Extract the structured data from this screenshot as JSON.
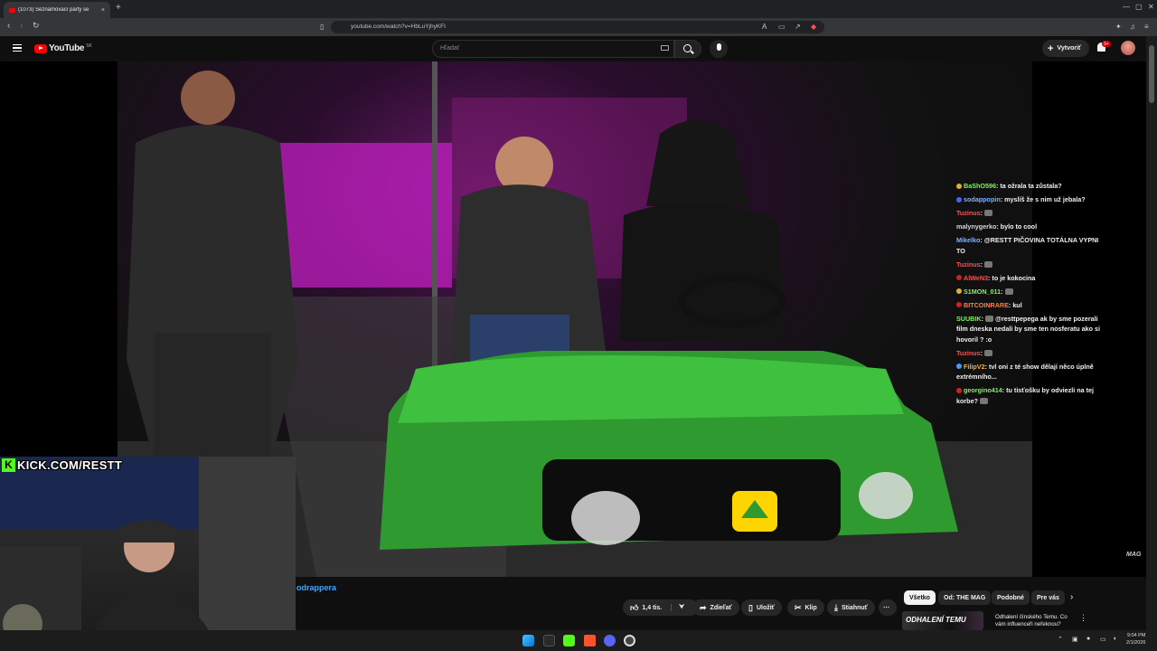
{
  "browser": {
    "tab_title": "(1073) Seznamovací party se",
    "url": "youtube.com/watch?v=HbLuYjhyKFI",
    "new_tab_label": "+",
    "close_tab_label": "×"
  },
  "youtube": {
    "logo_text": "YouTube",
    "region": "SK",
    "search_placeholder": "Hľadať",
    "create_label": "Vytvoriť",
    "notification_count": "9+"
  },
  "video": {
    "watermark": "MAG",
    "channel_name_partial": "odrappera"
  },
  "chat": {
    "messages": [
      {
        "user": "BaShO596",
        "user_color": "#7ef55a",
        "badge_color": "#e0b030",
        "text": "ta ožrala ta zůstala?"
      },
      {
        "user": "sodappopin",
        "user_color": "#7ab4ff",
        "badge_color": "#4466ff",
        "text": "myslíš že s nim už jebala?"
      },
      {
        "user": "Tuzinus",
        "user_color": "#ff5050",
        "badge_color": "",
        "text": "",
        "emote": true
      },
      {
        "user": "malynygerko",
        "user_color": "#d8d8d8",
        "badge_color": "",
        "text": "bylo to cool"
      },
      {
        "user": "Mikelko",
        "user_color": "#7ab4ff",
        "badge_color": "",
        "text": "@RESTT PIČOVINA TOTÁLNA VYPNI TO"
      },
      {
        "user": "Tuzinus",
        "user_color": "#ff5050",
        "badge_color": "",
        "text": "",
        "emote": true
      },
      {
        "user": "AlWeN3",
        "user_color": "#ff5050",
        "badge_color": "#cc2222",
        "text": "to je kokocina"
      },
      {
        "user": "S1MON_011",
        "user_color": "#7ef55a",
        "badge_color": "#e0b030",
        "text": "",
        "emote": true
      },
      {
        "user": "BITCOINRARE",
        "user_color": "#ff8040",
        "badge_color": "#cc2222",
        "text": "kul"
      },
      {
        "user": "SUUBIK",
        "user_color": "#7ef55a",
        "badge_color": "",
        "text": "@resttpepega ak by sme pozerali film dneska nedali by sme ten nosferatu ako si hovoril ? :o",
        "emote_before": true
      },
      {
        "user": "Tuzinus",
        "user_color": "#ff5050",
        "badge_color": "",
        "text": "",
        "emote": true
      },
      {
        "user": "FilipV2",
        "user_color": "#ffb040",
        "badge_color": "#4499ff",
        "text": "tvl oni z té show dělají něco úplně extrémního..."
      },
      {
        "user": "georgino414",
        "user_color": "#7ef55a",
        "badge_color": "#cc2222",
        "text": "tu tisťošku by odviezli na tej korbe?",
        "emote_after": true
      }
    ]
  },
  "stream_overlay": {
    "kick_logo": "K",
    "kick_url": "KICK.COM/RESTT"
  },
  "actions": {
    "like_count": "1,4 tis.",
    "share": "Zdieľať",
    "save": "Uložiť",
    "clip": "Klip",
    "download": "Stiahnuť",
    "more": "⋯"
  },
  "chips": [
    "Všetko",
    "Od: THE MAG",
    "Podobné",
    "Pre vás"
  ],
  "recommendation": {
    "thumb_text": "ODHALENÍ TEMU",
    "title": "Odhalení čínského Temu. Co vám influenceři neřeknou?"
  },
  "taskbar": {
    "time": "9:04 PM",
    "date": "2/1/2026"
  },
  "colors": {
    "accent_red": "#ff0000",
    "kick_green": "#53fc18",
    "link_blue": "#3ea6ff"
  }
}
